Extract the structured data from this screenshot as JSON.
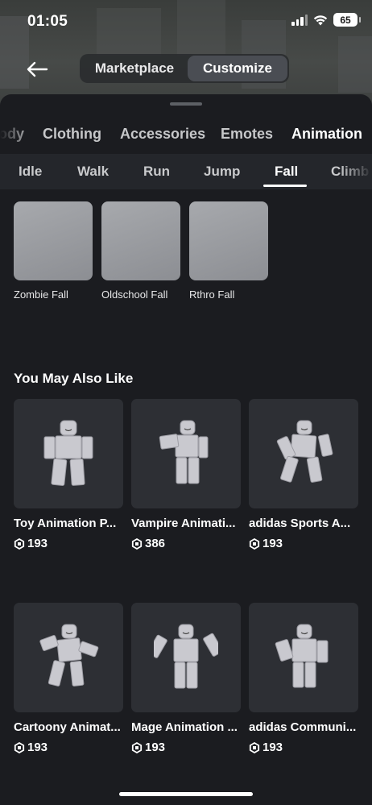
{
  "status_bar": {
    "time": "01:05",
    "battery": "65"
  },
  "header": {
    "tabs": [
      {
        "label": "Marketplace",
        "active": false
      },
      {
        "label": "Customize",
        "active": true
      }
    ]
  },
  "category_tabs": [
    {
      "label": "Body",
      "visible_text": "ody"
    },
    {
      "label": "Clothing"
    },
    {
      "label": "Accessories"
    },
    {
      "label": "Emotes"
    },
    {
      "label": "Animation",
      "active": true
    }
  ],
  "sub_tabs": [
    {
      "label": "Idle"
    },
    {
      "label": "Walk"
    },
    {
      "label": "Run"
    },
    {
      "label": "Jump"
    },
    {
      "label": "Fall",
      "active": true
    },
    {
      "label": "Climb"
    }
  ],
  "owned_animations": [
    {
      "name": "Zombie Fall"
    },
    {
      "name": "Oldschool Fall"
    },
    {
      "name": "Rthro Fall"
    }
  ],
  "recommendations": {
    "title": "You May Also Like",
    "items": [
      {
        "name": "Toy Animation P...",
        "price": "193"
      },
      {
        "name": "Vampire Animati...",
        "price": "386"
      },
      {
        "name": "adidas Sports A...",
        "price": "193"
      },
      {
        "name": "Cartoony Animat...",
        "price": "193"
      },
      {
        "name": "Mage Animation ...",
        "price": "193"
      },
      {
        "name": "adidas Communi...",
        "price": "193"
      }
    ]
  },
  "colors": {
    "background": "#1b1c20",
    "subtab_bar": "#24262b",
    "card": "#2d2f34",
    "accent_text": "#ffffff"
  }
}
